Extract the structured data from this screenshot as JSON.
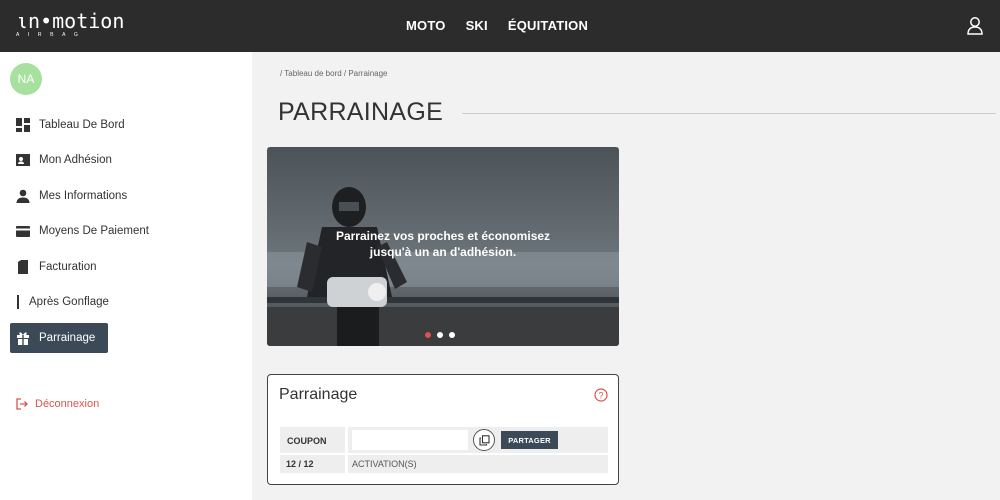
{
  "header": {
    "logo_main": "ιn•motion",
    "logo_sub": "AIRBAG",
    "nav": [
      "MOTO",
      "SKI",
      "ÉQUITATION"
    ]
  },
  "sidebar": {
    "avatar_initials": "NA",
    "items": [
      {
        "label": "Tableau De Bord",
        "icon": "dashboard-icon"
      },
      {
        "label": "Mon Adhésion",
        "icon": "id-card-icon"
      },
      {
        "label": "Mes Informations",
        "icon": "person-icon"
      },
      {
        "label": "Moyens De Paiement",
        "icon": "credit-card-icon"
      },
      {
        "label": "Facturation",
        "icon": "document-icon"
      },
      {
        "label": "Après Gonflage",
        "icon": "vertical-bar-icon"
      },
      {
        "label": "Parrainage",
        "icon": "gift-icon",
        "active": true
      }
    ],
    "logout_label": "Déconnexion"
  },
  "main": {
    "breadcrumb": "/ Tableau de bord / Parrainage",
    "title": "PARRAINAGE",
    "banner": {
      "line1": "Parrainez vos proches et économisez",
      "line2": "jusqu'à un an d'adhésion.",
      "slides": 3,
      "active_slide": 1
    },
    "card": {
      "title": "Parrainage",
      "coupon_label": "COUPON",
      "coupon_value": "",
      "share_label": "PARTAGER",
      "count": "12 / 12",
      "activation_label": "ACTIVATION(S)"
    }
  },
  "colors": {
    "topbar": "#2c2c2c",
    "active_item": "#3b4a56",
    "logout": "#d9534f",
    "avatar": "#a8e0a0"
  }
}
